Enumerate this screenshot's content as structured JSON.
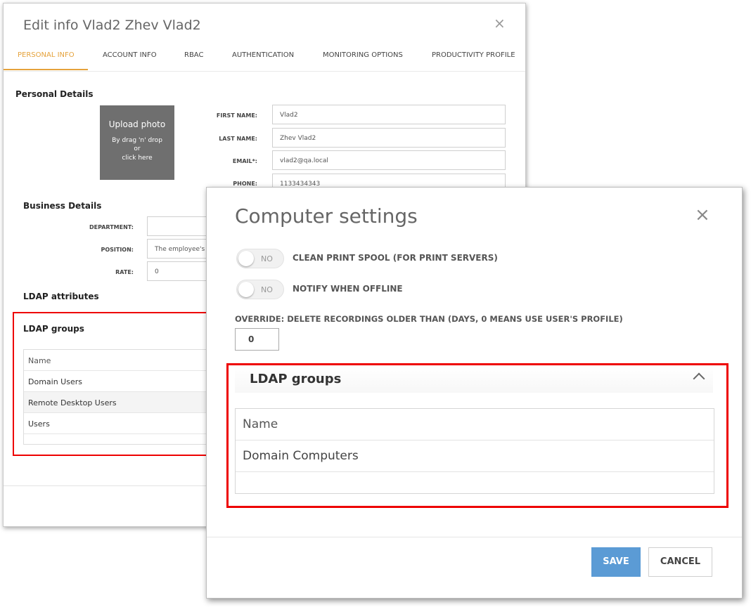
{
  "edit_dialog": {
    "title": "Edit info Vlad2 Zhev Vlad2",
    "close_glyph": "×",
    "tabs": [
      {
        "label": "PERSONAL INFO",
        "active": true
      },
      {
        "label": "ACCOUNT INFO",
        "active": false
      },
      {
        "label": "RBAC",
        "active": false
      },
      {
        "label": "AUTHENTICATION",
        "active": false
      },
      {
        "label": "MONITORING OPTIONS",
        "active": false
      },
      {
        "label": "PRODUCTIVITY PROFILE",
        "active": false
      }
    ],
    "personal_details": {
      "title": "Personal Details",
      "upload": {
        "title": "Upload photo",
        "line1": "By drag 'n' drop",
        "line2": "or",
        "line3": "click here"
      },
      "fields": [
        {
          "label": "FIRST NAME:",
          "value": "Vlad2"
        },
        {
          "label": "LAST NAME:",
          "value": "Zhev Vlad2"
        },
        {
          "label": "EMAIL*:",
          "value": "vlad2@qa.local"
        },
        {
          "label": "PHONE:",
          "value": "1133434343"
        }
      ]
    },
    "business_details": {
      "title": "Business Details",
      "fields": [
        {
          "label": "DEPARTMENT:",
          "value": ""
        },
        {
          "label": "POSITION:",
          "value": "The employee's"
        },
        {
          "label": "RATE:",
          "value": "0"
        }
      ]
    },
    "ldap_attributes_title": "LDAP attributes",
    "ldap_groups": {
      "title": "LDAP groups",
      "header": "Name",
      "rows": [
        "Domain Users",
        "Remote Desktop Users",
        "Users"
      ]
    }
  },
  "computer_dialog": {
    "title": "Computer settings",
    "close_glyph": "×",
    "toggles": [
      {
        "state": "NO",
        "label": "CLEAN PRINT SPOOL (FOR PRINT SERVERS)"
      },
      {
        "state": "NO",
        "label": "NOTIFY WHEN OFFLINE"
      }
    ],
    "override": {
      "label": "OVERRIDE: DELETE RECORDINGS OLDER THAN (DAYS, 0 MEANS USE USER'S PROFILE)",
      "value": "0"
    },
    "ldap_groups": {
      "title": "LDAP groups",
      "header": "Name",
      "rows": [
        "Domain Computers"
      ]
    },
    "buttons": {
      "save": "SAVE",
      "cancel": "CANCEL"
    }
  },
  "colors": {
    "accent_tab": "#e5a23b",
    "highlight_box": "#ee0000",
    "save_button": "#5b9bd5"
  }
}
